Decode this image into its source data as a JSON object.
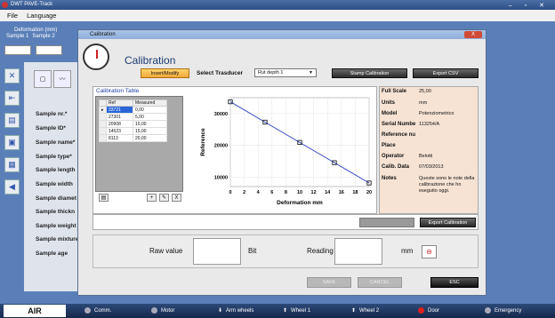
{
  "window": {
    "title": "DWT PAVE-Track",
    "controls": "– ▫ ✕"
  },
  "menu": {
    "items": [
      "File",
      "Language"
    ]
  },
  "deformation": {
    "label_line1": "Deformation (mm)",
    "sample1": "Sample 1",
    "sample2": "Sample 2"
  },
  "sample_fields": [
    "Sample nr.*",
    "Sample ID*",
    "Sample name*",
    "Sample type*",
    "Sample length",
    "Sample width",
    "Sample diamet",
    "Sample thickn",
    "Sample weight",
    "Sample mixture",
    "Sample age"
  ],
  "dialog": {
    "window_title": "Calibration",
    "close_label": "X",
    "heading": "Calibration",
    "insert_modify": "Insert/Modify",
    "select_trasducer_label": "Select Trasducer",
    "trasducer_value": "Rut depth 1",
    "stamp_calibration": "Stamp Calibration",
    "export_csv": "Export CSV",
    "calibration_table_title": "Calibration Table",
    "table_headers": [
      "Ref",
      "Measured"
    ],
    "rows": [
      {
        "ref": "33721",
        "measured": "0,00"
      },
      {
        "ref": "27301",
        "measured": "5,00"
      },
      {
        "ref": "20908",
        "measured": "10,00"
      },
      {
        "ref": "14523",
        "measured": "15,00"
      },
      {
        "ref": "8113",
        "measured": "20,00"
      }
    ],
    "export_calibration": "Export Calibration",
    "raw_value_label": "Raw value",
    "bit_label": "Bit",
    "reading_label": "Reading",
    "mm_label": "mm",
    "save": "SAVE",
    "cancel": "CANCEL",
    "esc": "ESC"
  },
  "properties": [
    {
      "label": "Full Scale",
      "value": "25,00"
    },
    {
      "label": "Units",
      "value": "mm"
    },
    {
      "label": "Model",
      "value": "Potenziometrico"
    },
    {
      "label": "Serial Numbe",
      "value": "113254/A"
    },
    {
      "label": "Reference nu",
      "value": ""
    },
    {
      "label": "Place",
      "value": ""
    },
    {
      "label": "Operator",
      "value": "Belotti"
    },
    {
      "label": "Calib. Data",
      "value": "07/03/2013"
    },
    {
      "label": "Notes",
      "value": "Queste sono le note della calibrazione che ho eseguito oggi."
    }
  ],
  "chart_data": {
    "type": "line",
    "xlabel": "Deformation mm",
    "ylabel": "Reference",
    "xlim": [
      0,
      20
    ],
    "ylim": [
      7000,
      35000
    ],
    "xticks": [
      0,
      2,
      4,
      6,
      8,
      10,
      12,
      14,
      16,
      18,
      20
    ],
    "yticks": [
      10000,
      20000,
      30000
    ],
    "x": [
      0,
      5,
      10,
      15,
      20
    ],
    "y": [
      33721,
      27301,
      20908,
      14523,
      8113
    ]
  },
  "taskbar": {
    "air": "AIR",
    "items": [
      "Comm.",
      "Motor",
      "Arm wheels",
      "Wheel 1",
      "Wheel 2",
      "Door",
      "Emergency"
    ],
    "colors": [
      "#cfd6e6",
      "#cfd6e6",
      "#cfd6e6",
      "#cfd6e6",
      "#cfd6e6",
      "#e02020",
      "#cfd6e6"
    ]
  }
}
